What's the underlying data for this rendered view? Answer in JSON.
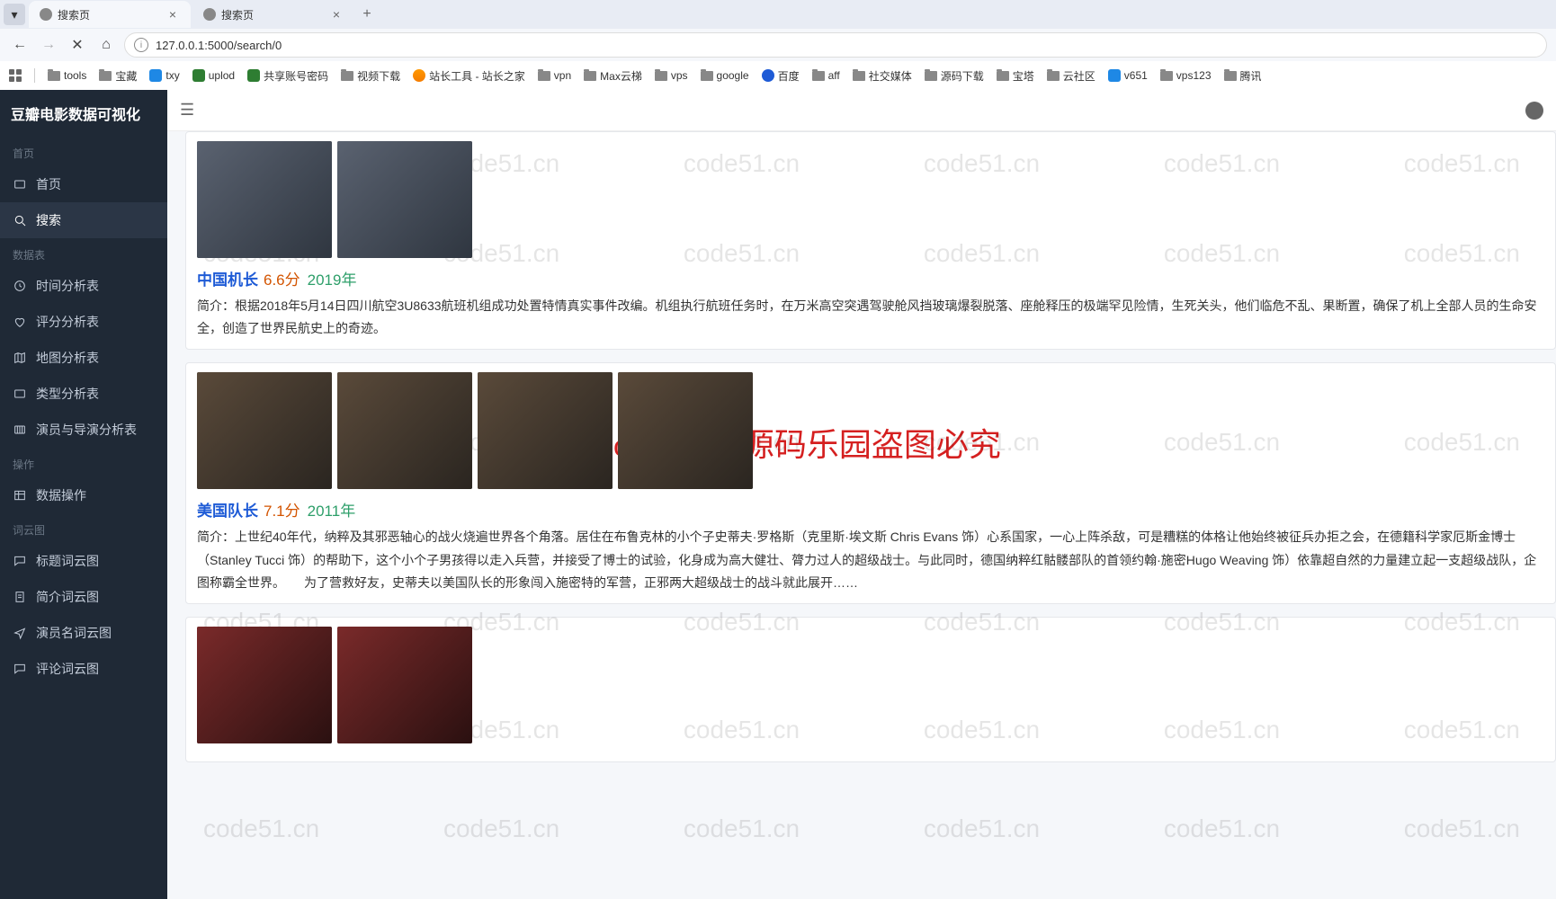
{
  "browser": {
    "tabs": [
      {
        "title": "搜索页",
        "active": true
      },
      {
        "title": "搜索页",
        "active": false
      }
    ],
    "url": "127.0.0.1:5000/search/0",
    "bookmarks": [
      {
        "icon": "apps",
        "label": ""
      },
      {
        "icon": "divider"
      },
      {
        "icon": "folder",
        "label": "tools"
      },
      {
        "icon": "folder",
        "label": "宝藏"
      },
      {
        "icon": "dot-blue",
        "label": "txy"
      },
      {
        "icon": "dot-green",
        "label": "uplod"
      },
      {
        "icon": "dot-green",
        "label": "共享账号密码"
      },
      {
        "icon": "folder",
        "label": "视频下载"
      },
      {
        "icon": "dot-orange",
        "label": "站长工具 - 站长之家"
      },
      {
        "icon": "folder",
        "label": "vpn"
      },
      {
        "icon": "folder",
        "label": "Max云梯"
      },
      {
        "icon": "folder",
        "label": "vps"
      },
      {
        "icon": "folder",
        "label": "google"
      },
      {
        "icon": "dot-paw",
        "label": "百度"
      },
      {
        "icon": "folder",
        "label": "aff"
      },
      {
        "icon": "folder",
        "label": "社交媒体"
      },
      {
        "icon": "folder",
        "label": "源码下载"
      },
      {
        "icon": "folder",
        "label": "宝塔"
      },
      {
        "icon": "folder",
        "label": "云社区"
      },
      {
        "icon": "dot-blue",
        "label": "v651"
      },
      {
        "icon": "folder",
        "label": "vps123"
      },
      {
        "icon": "folder",
        "label": "腾讯"
      }
    ]
  },
  "sidebar": {
    "brand": "豆瓣电影数据可视化",
    "sections": [
      {
        "title": "首页",
        "items": [
          {
            "icon": "home",
            "label": "首页",
            "active": false
          },
          {
            "icon": "search",
            "label": "搜索",
            "active": true
          }
        ]
      },
      {
        "title": "数据表",
        "items": [
          {
            "icon": "clock",
            "label": "时间分析表"
          },
          {
            "icon": "heart",
            "label": "评分分析表"
          },
          {
            "icon": "map",
            "label": "地图分析表"
          },
          {
            "icon": "grid",
            "label": "类型分析表"
          },
          {
            "icon": "people",
            "label": "演员与导演分析表"
          }
        ]
      },
      {
        "title": "操作",
        "items": [
          {
            "icon": "table",
            "label": "数据操作"
          }
        ]
      },
      {
        "title": "词云图",
        "items": [
          {
            "icon": "chat",
            "label": "标题词云图"
          },
          {
            "icon": "doc",
            "label": "简介词云图"
          },
          {
            "icon": "send",
            "label": "演员名词云图"
          },
          {
            "icon": "chat",
            "label": "评论词云图"
          }
        ]
      }
    ]
  },
  "movies": [
    {
      "title": "中国机长",
      "score": "6.6分",
      "year": "2019年",
      "desc": "简介：根据2018年5月14日四川航空3U8633航班机组成功处置特情真实事件改编。机组执行航班任务时，在万米高空突遇驾驶舱风挡玻璃爆裂脱落、座舱释压的极端罕见险情，生死关头，他们临危不乱、果断置，确保了机上全部人员的生命安全，创造了世界民航史上的奇迹。",
      "thumb_count": 2,
      "thumb_class": ""
    },
    {
      "title": "美国队长",
      "score": "7.1分",
      "year": "2011年",
      "desc": "简介：上世纪40年代，纳粹及其邪恶轴心的战火烧遍世界各个角落。居住在布鲁克林的小个子史蒂夫·罗格斯（克里斯·埃文斯 Chris Evans 饰）心系国家，一心上阵杀敌，可是糟糕的体格让他始终被征兵办拒之会，在德籍科学家厄斯金博士（Stanley Tucci 饰）的帮助下，这个小个子男孩得以走入兵营，并接受了博士的试验，化身成为高大健壮、膂力过人的超级战士。与此同时，德国纳粹红骷髅部队的首领约翰·施密Hugo Weaving 饰）依靠超自然的力量建立起一支超级战队，企图称霸全世界。　　为了营救好友，史蒂夫以美国队长的形象闯入施密特的军营，正邪两大超级战士的战斗就此展开……",
      "thumb_count": 4,
      "thumb_class": "captain"
    },
    {
      "title": "",
      "score": "",
      "year": "",
      "desc": "",
      "thumb_count": 2,
      "thumb_class": "spider"
    }
  ],
  "watermark": {
    "grey": "code51.cn",
    "red": "code51.cn-源码乐园盗图必究"
  }
}
